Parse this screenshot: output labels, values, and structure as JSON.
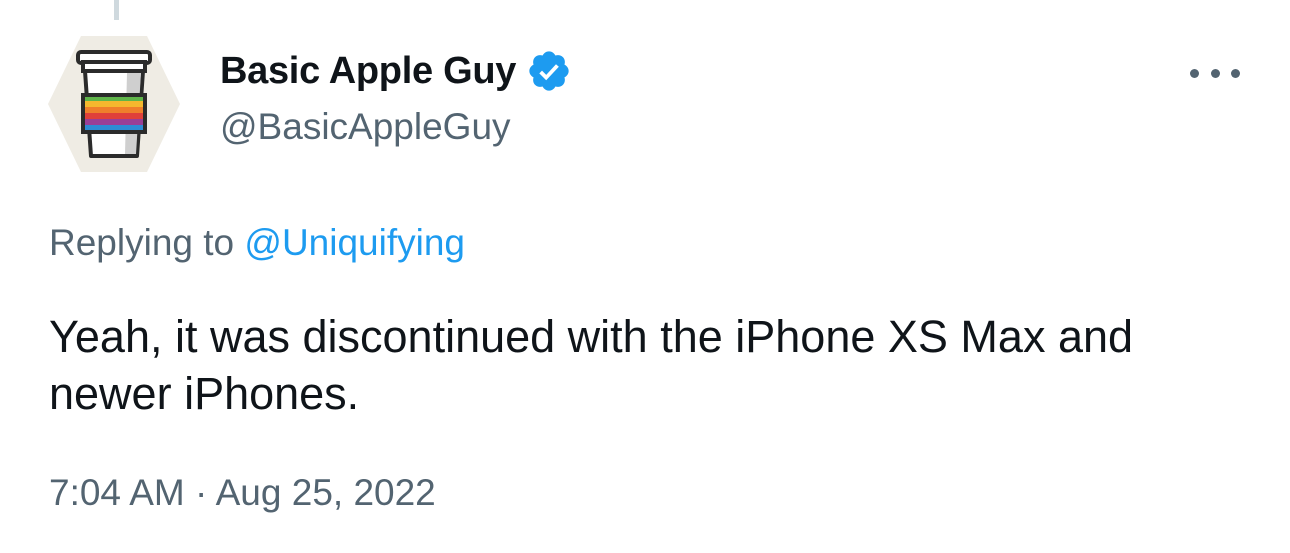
{
  "tweet": {
    "author": {
      "display_name": "Basic Apple Guy",
      "handle": "@BasicAppleGuy",
      "verified": true,
      "avatar_icon": "coffee-cup-rainbow-icon"
    },
    "reply_prefix": "Replying to",
    "reply_to": "@Uniquifying",
    "text": "Yeah, it was discontinued with the iPhone XS Max and newer iPhones.",
    "time": "7:04 AM",
    "separator": "·",
    "date": "Aug 25, 2022"
  },
  "colors": {
    "text_primary": "#0f1419",
    "text_secondary": "#536471",
    "accent": "#1d9bf0",
    "thread_line": "#cfd9de"
  },
  "icons": {
    "verified": "verified-badge-icon",
    "more": "more-options-icon"
  }
}
